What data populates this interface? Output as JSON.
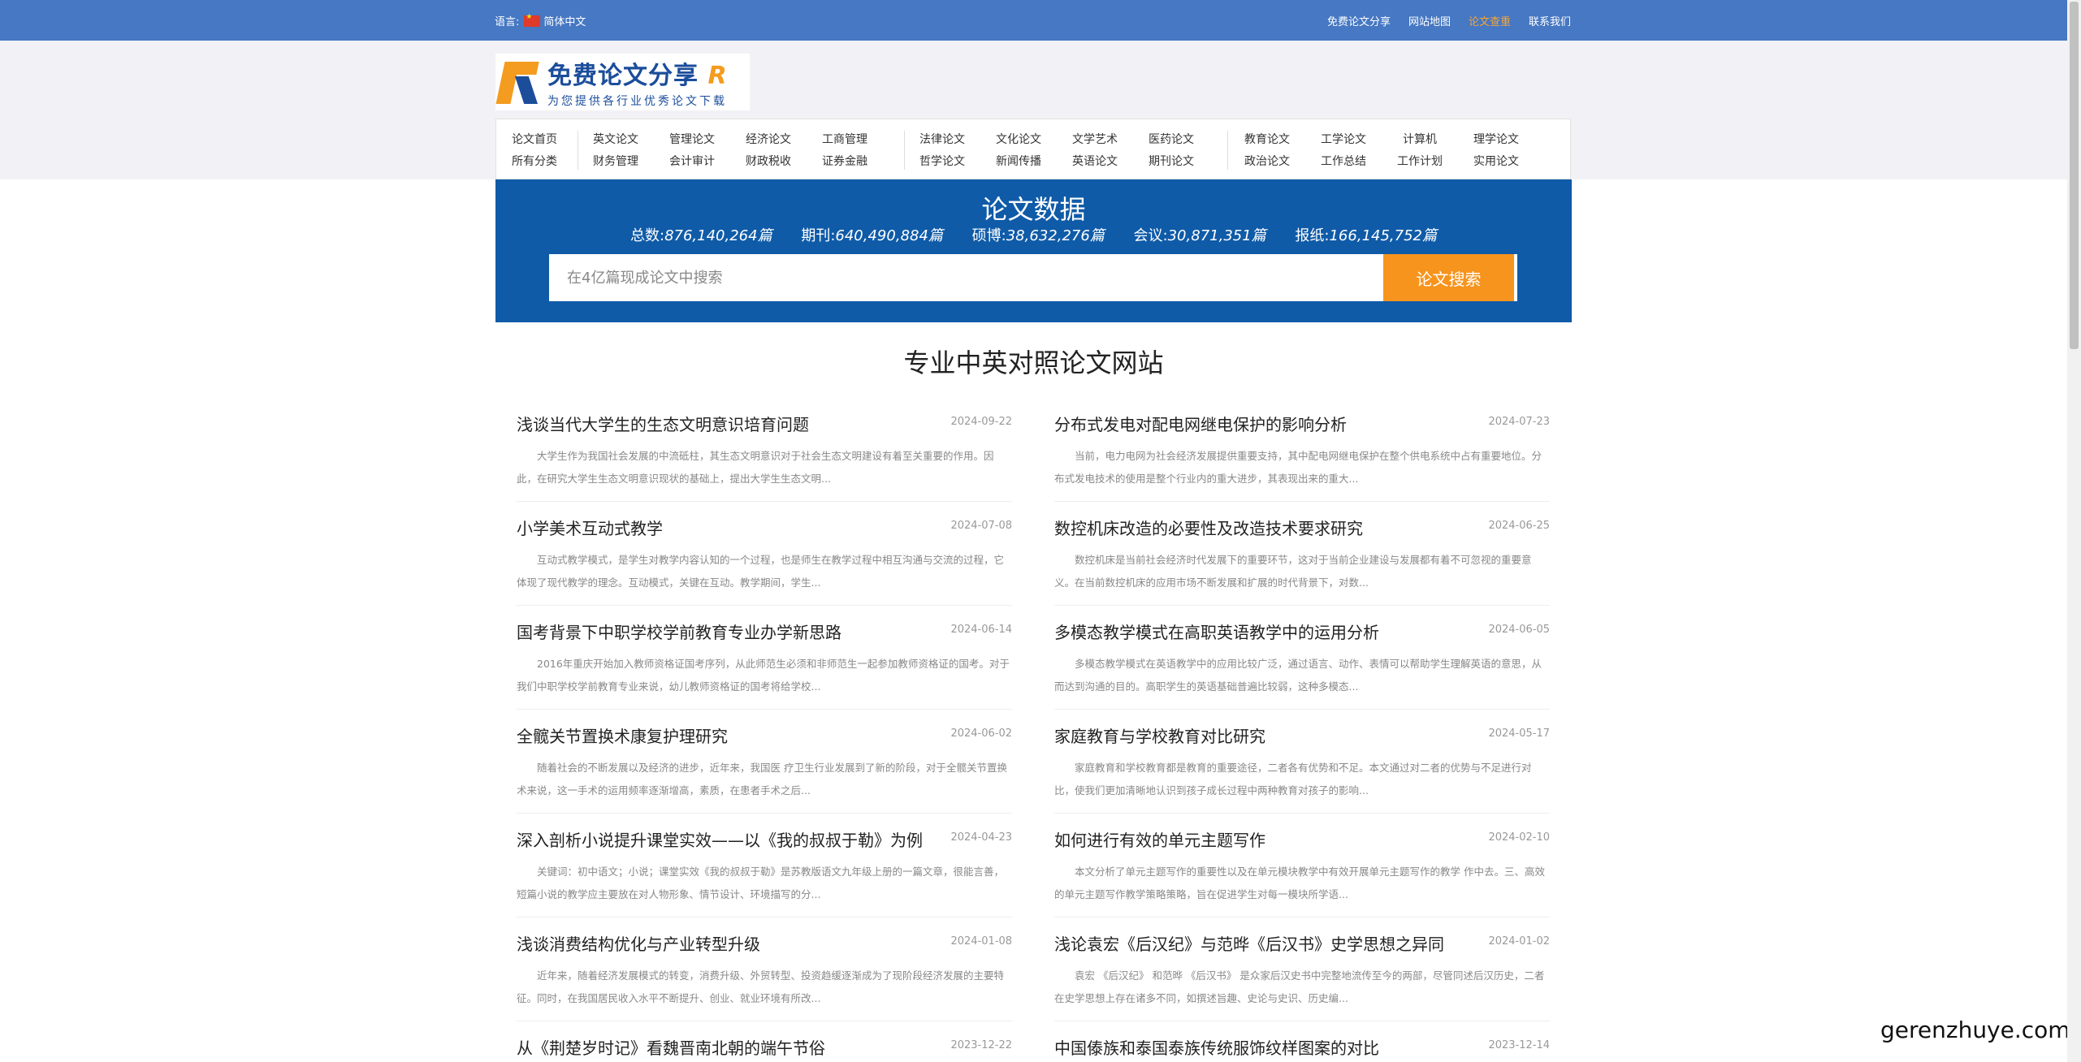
{
  "topbar": {
    "lang_label": "语言:",
    "lang_value": "简体中文",
    "nav": [
      {
        "label": "免费论文分享",
        "highlight": false
      },
      {
        "label": "网站地图",
        "highlight": false
      },
      {
        "label": "论文查重",
        "highlight": true
      },
      {
        "label": "联系我们",
        "highlight": false
      }
    ]
  },
  "logo": {
    "title": "免费论文分享",
    "subtitle": "为您提供各行业优秀论文下载"
  },
  "categories": [
    [
      "论文首页",
      "所有分类"
    ],
    [
      "英文论文",
      "财务管理"
    ],
    [
      "管理论文",
      "会计审计"
    ],
    [
      "经济论文",
      "财政税收"
    ],
    [
      "工商管理",
      "证券金融"
    ],
    [
      "法律论文",
      "哲学论文"
    ],
    [
      "文化论文",
      "新闻传播"
    ],
    [
      "文学艺术",
      "英语论文"
    ],
    [
      "医药论文",
      "期刊论文"
    ],
    [
      "教育论文",
      "政治论文"
    ],
    [
      "工学论文",
      "工作总结"
    ],
    [
      "计算机",
      "工作计划"
    ],
    [
      "理学论文",
      "实用论文"
    ]
  ],
  "hero": {
    "title": "论文数据",
    "stats": [
      {
        "label": "总数:",
        "value": "876,140,264篇"
      },
      {
        "label": "期刊:",
        "value": "640,490,884篇"
      },
      {
        "label": "硕博:",
        "value": "38,632,276篇"
      },
      {
        "label": "会议:",
        "value": "30,871,351篇"
      },
      {
        "label": "报纸:",
        "value": "166,145,752篇"
      }
    ],
    "search_placeholder": "在4亿篇现成论文中搜索",
    "search_button": "论文搜索"
  },
  "section_title": "专业中英对照论文网站",
  "articles": [
    {
      "title": "浅谈当代大学生的生态文明意识培育问题",
      "date": "2024-09-22",
      "abstract": "大学生作为我国社会发展的中流砥柱，其生态文明意识对于社会生态文明建设有着至关重要的作用。因此，在研究大学生生态文明意识现状的基础上，提出大学生生态文明..."
    },
    {
      "title": "分布式发电对配电网继电保护的影响分析",
      "date": "2024-07-23",
      "abstract": "当前，电力电网为社会经济发展提供重要支持，其中配电网继电保护在整个供电系统中占有重要地位。分布式发电技术的使用是整个行业内的重大进步，其表现出来的重大..."
    },
    {
      "title": "小学美术互动式教学",
      "date": "2024-07-08",
      "abstract": "互动式教学模式，是学生对教学内容认知的一个过程，也是师生在教学过程中相互沟通与交流的过程，它体现了现代教学的理念。互动模式，关键在互动。教学期间，学生..."
    },
    {
      "title": "数控机床改造的必要性及改造技术要求研究",
      "date": "2024-06-25",
      "abstract": "数控机床是当前社会经济时代发展下的重要环节，这对于当前企业建设与发展都有着不可忽视的重要意义。在当前数控机床的应用市场不断发展和扩展的时代背景下，对数..."
    },
    {
      "title": "国考背景下中职学校学前教育专业办学新思路",
      "date": "2024-06-14",
      "abstract": "2016年重庆开始加入教师资格证国考序列，从此师范生必须和非师范生一起参加教师资格证的国考。对于我们中职学校学前教育专业来说，幼儿教师资格证的国考将给学校..."
    },
    {
      "title": "多模态教学模式在高职英语教学中的运用分析",
      "date": "2024-06-05",
      "abstract": "多模态教学模式在英语教学中的应用比较广泛，通过语言、动作、表情可以帮助学生理解英语的意思，从而达到沟通的目的。高职学生的英语基础普遍比较弱，这种多模态..."
    },
    {
      "title": "全髋关节置换术康复护理研究",
      "date": "2024-06-02",
      "abstract": "随着社会的不断发展以及经济的进步，近年来，我国医 疗卫生行业发展到了新的阶段，对于全髋关节置换术来说，这一手术的运用频率逐渐增高，素质，在患者手术之后..."
    },
    {
      "title": "家庭教育与学校教育对比研究",
      "date": "2024-05-17",
      "abstract": "家庭教育和学校教育都是教育的重要途径，二者各有优势和不足。本文通过对二者的优势与不足进行对比，使我们更加清晰地认识到孩子成长过程中两种教育对孩子的影响..."
    },
    {
      "title": "深入剖析小说提升课堂实效——以《我的叔叔于勒》为例",
      "date": "2024-04-23",
      "abstract": "关键词：初中语文；小说；课堂实效《我的叔叔于勒》是苏教版语文九年级上册的一篇文章，很能言善，短篇小说的教学应主要放在对人物形象、情节设计、环境描写的分..."
    },
    {
      "title": "如何进行有效的单元主题写作",
      "date": "2024-02-10",
      "abstract": "本文分析了单元主题写作的重要性以及在单元模块教学中有效开展单元主题写作的教学 作中去。三、高效的单元主题写作教学策略策略，旨在促进学生对每一模块所学语..."
    },
    {
      "title": "浅谈消费结构优化与产业转型升级",
      "date": "2024-01-08",
      "abstract": "近年来，随着经济发展模式的转变，消费升级、外贸转型、投资趋缓逐渐成为了现阶段经济发展的主要特征。同时，在我国居民收入水平不断提升、创业、就业环境有所改..."
    },
    {
      "title": "浅论袁宏《后汉纪》与范晔《后汉书》史学思想之异同",
      "date": "2024-01-02",
      "abstract": "袁宏 《后汉纪》 和范晔 《后汉书》 是众家后汉史书中完整地流传至今的两部，尽管同述后汉历史，二者在史学思想上存在诸多不同，如撰述旨趣、史论与史识、历史编..."
    },
    {
      "title": "从《荆楚岁时记》看魏晋南北朝的端午节俗",
      "date": "2023-12-22",
      "abstract": ""
    },
    {
      "title": "中国傣族和泰国泰族传统服饰纹样图案的对比",
      "date": "2023-12-14",
      "abstract": ""
    }
  ],
  "watermark": "gerenzhuye.com"
}
